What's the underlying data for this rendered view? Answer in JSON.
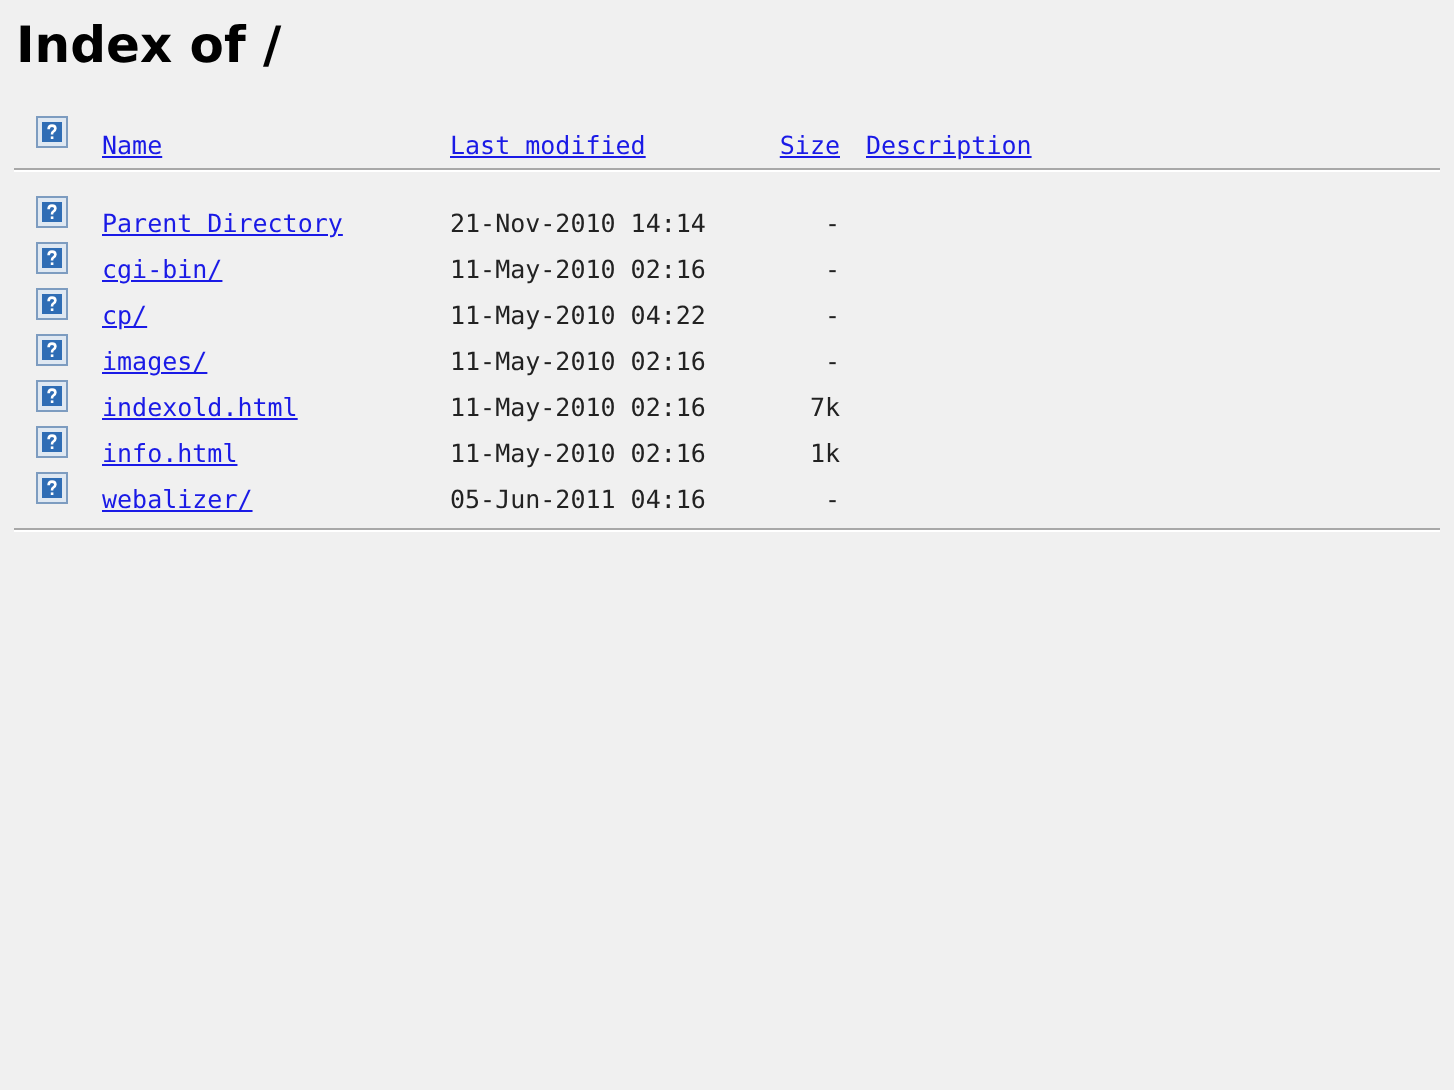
{
  "title": "Index of /",
  "columns": [
    {
      "label": "Name"
    },
    {
      "label": "Last modified"
    },
    {
      "label": "Size"
    },
    {
      "label": "Description"
    }
  ],
  "rows": [
    {
      "name": "Parent Directory",
      "modified": "21-Nov-2010 14:14",
      "size": "-"
    },
    {
      "name": "cgi-bin/",
      "modified": "11-May-2010 02:16",
      "size": "-"
    },
    {
      "name": "cp/",
      "modified": "11-May-2010 04:22",
      "size": "-"
    },
    {
      "name": "images/",
      "modified": "11-May-2010 02:16",
      "size": "-"
    },
    {
      "name": "indexold.html",
      "modified": "11-May-2010 02:16",
      "size": "7k"
    },
    {
      "name": "info.html",
      "modified": "11-May-2010 02:16",
      "size": "1k"
    },
    {
      "name": "webalizer/",
      "modified": "05-Jun-2011 04:16",
      "size": "-"
    }
  ]
}
